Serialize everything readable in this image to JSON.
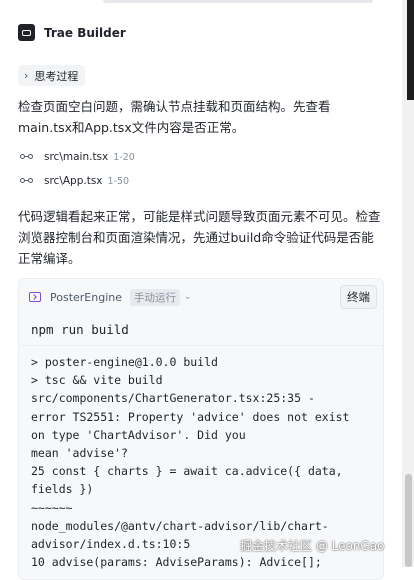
{
  "agent": {
    "name": "Trae Builder",
    "icon": "bot-icon"
  },
  "thinking": {
    "label": "思考过程"
  },
  "messages": {
    "para1": "检查页面空白问题，需确认节点挂载和页面结构。先查看main.tsx和App.tsx文件内容是否正常。",
    "para2": "代码逻辑看起来正常，可能是样式问题导致页面元素不可见。检查浏览器控制台和页面渲染情况，先通过build命令验证代码是否能正常编译。"
  },
  "files": [
    {
      "path": "src\\main.tsx",
      "range": "1-20"
    },
    {
      "path": "src\\App.tsx",
      "range": "1-50"
    }
  ],
  "terminal": {
    "name": "PosterEngine",
    "mode": "手动运行",
    "stop_label": "终端",
    "command": "npm run build",
    "output": [
      "> poster-engine@1.0.0 build",
      "> tsc && vite build",
      "src/components/ChartGenerator.tsx:25:35 -",
      "error TS2551: Property 'advice' does not exist",
      "on type 'ChartAdvisor'. Did you",
      "mean 'advise'?",
      "25 const { charts } = await ca.advice({ data,",
      "fields })",
      "~~~~~~",
      "node_modules/@antv/chart-advisor/lib/chart-",
      "advisor/index.d.ts:10:5",
      "10 advise(params: AdviseParams): Advice[];"
    ]
  },
  "watermark": "掘金技术社区 @ LeonGao",
  "colors": {
    "accent": "#7d4bd6",
    "text": "#1f2329",
    "muted": "#86909c",
    "panel": "#f7f8fa"
  }
}
